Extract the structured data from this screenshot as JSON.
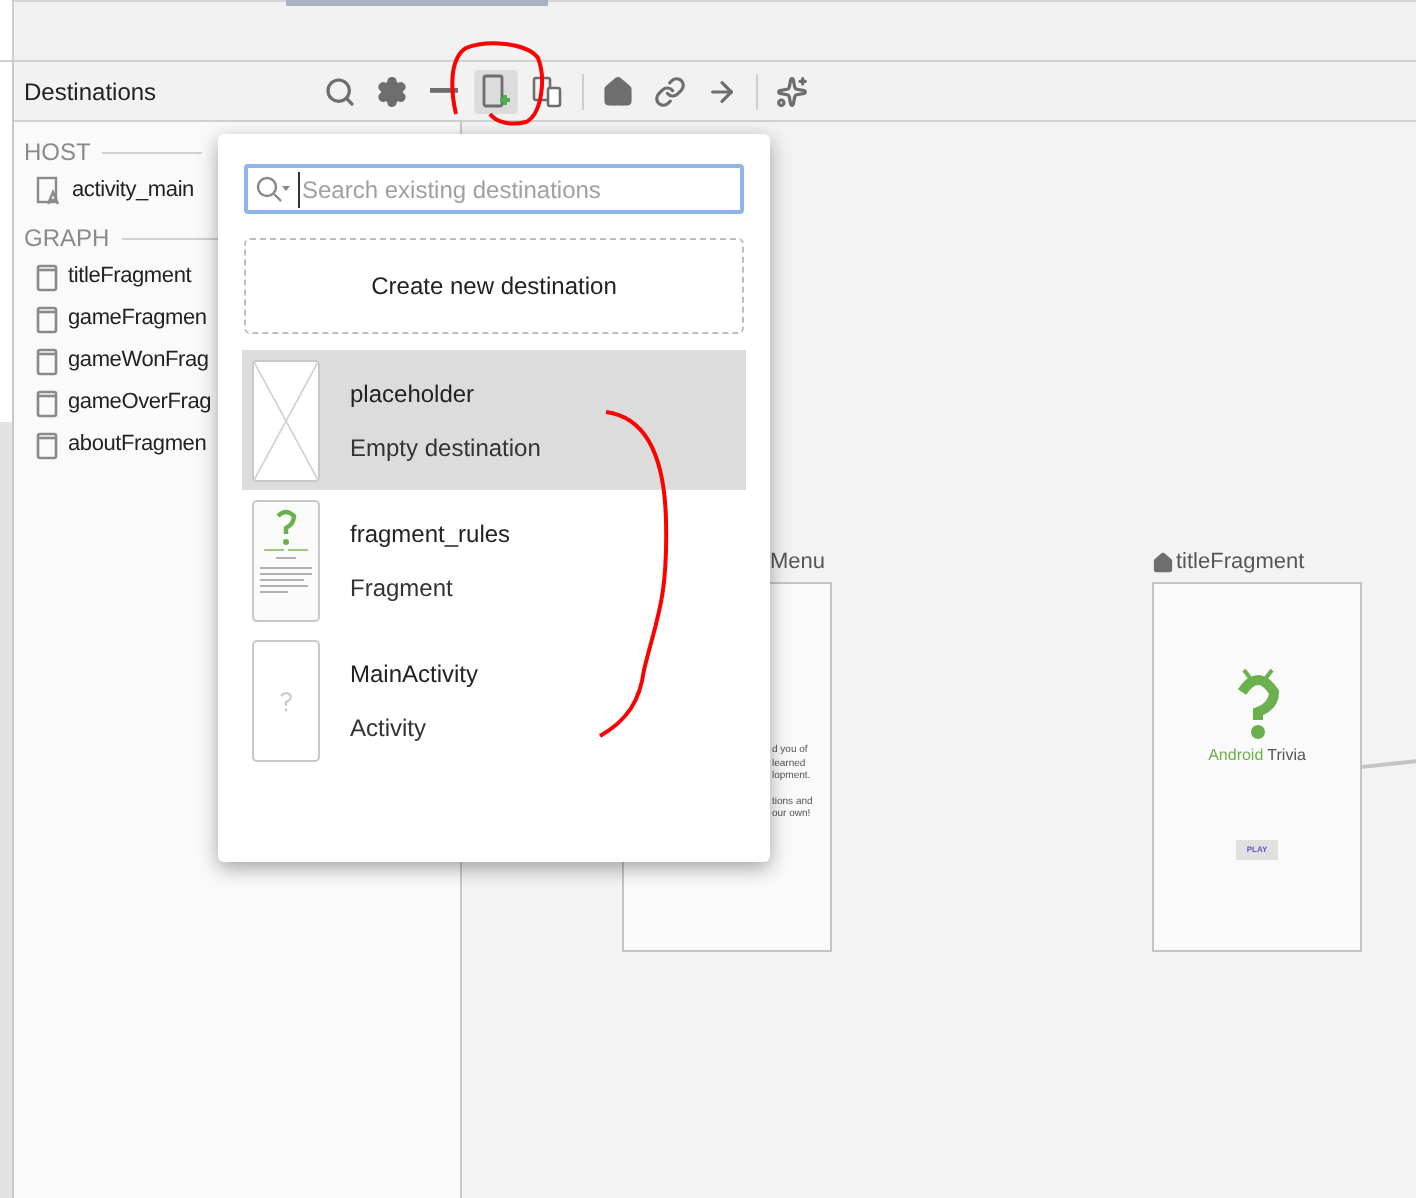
{
  "panel": {
    "title": "Destinations"
  },
  "toolbar": [
    {
      "kind": "search",
      "selected": false
    },
    {
      "kind": "settings",
      "selected": false
    },
    {
      "kind": "minus",
      "selected": false
    },
    {
      "kind": "new",
      "selected": true
    },
    {
      "kind": "devices",
      "selected": false
    },
    {
      "kind": "home",
      "selected": false
    },
    {
      "kind": "link",
      "selected": false
    },
    {
      "kind": "arrow",
      "selected": false
    },
    {
      "kind": "sparkle",
      "selected": false
    }
  ],
  "sections": [
    {
      "title": "HOST",
      "items": [
        {
          "kind": "layout",
          "label": "activity_main"
        }
      ]
    },
    {
      "title": "GRAPH",
      "items": [
        {
          "kind": "fragment",
          "label": "titleFragment"
        },
        {
          "kind": "fragment",
          "label": "gameFragmen"
        },
        {
          "kind": "fragment",
          "label": "gameWonFrag"
        },
        {
          "kind": "fragment",
          "label": "gameOverFrag"
        },
        {
          "kind": "fragment",
          "label": "aboutFragmen"
        }
      ]
    }
  ],
  "popup": {
    "search": {
      "placeholder": "Search existing destinations"
    },
    "create_button": "Create new destination",
    "destinations": [
      {
        "kind": "empty",
        "name": "placeholder",
        "type": "Empty destination",
        "selected": true
      },
      {
        "kind": "fragment",
        "name": "fragment_rules",
        "type": "Fragment",
        "selected": false
      },
      {
        "kind": "unknown",
        "name": "MainActivity",
        "type": "Activity",
        "selected": false
      }
    ]
  },
  "canvas": {
    "nodes": [
      {
        "kind": "text",
        "label": "Menu",
        "home": false,
        "lines": [
          "d you of",
          "learned",
          "lopment.",
          "tions and",
          "our own!"
        ]
      },
      {
        "kind": "title",
        "label": "titleFragment",
        "home": true,
        "app_name": [
          "Android",
          "Trivia"
        ],
        "button": "PLAY"
      }
    ]
  }
}
